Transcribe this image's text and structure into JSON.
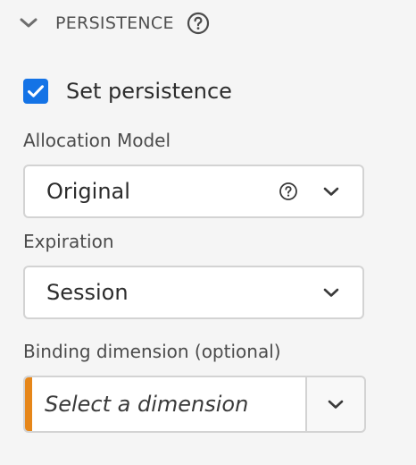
{
  "section": {
    "title": "PERSISTENCE",
    "collapse_icon": "chevron-down-icon",
    "help_icon": "help-circle-icon"
  },
  "persistence": {
    "checkbox_label": "Set persistence",
    "checked": true
  },
  "allocation_model": {
    "label": "Allocation Model",
    "value": "Original",
    "help_icon": "help-circle-icon",
    "chevron_icon": "chevron-down-icon"
  },
  "expiration": {
    "label": "Expiration",
    "value": "Session",
    "chevron_icon": "chevron-down-icon"
  },
  "binding_dimension": {
    "label": "Binding dimension (optional)",
    "placeholder": "Select a dimension",
    "chevron_icon": "chevron-down-icon"
  },
  "colors": {
    "accent": "#1473e6",
    "warning_bar": "#e68619",
    "background": "#f5f5f5",
    "border": "#d3d3d3"
  }
}
